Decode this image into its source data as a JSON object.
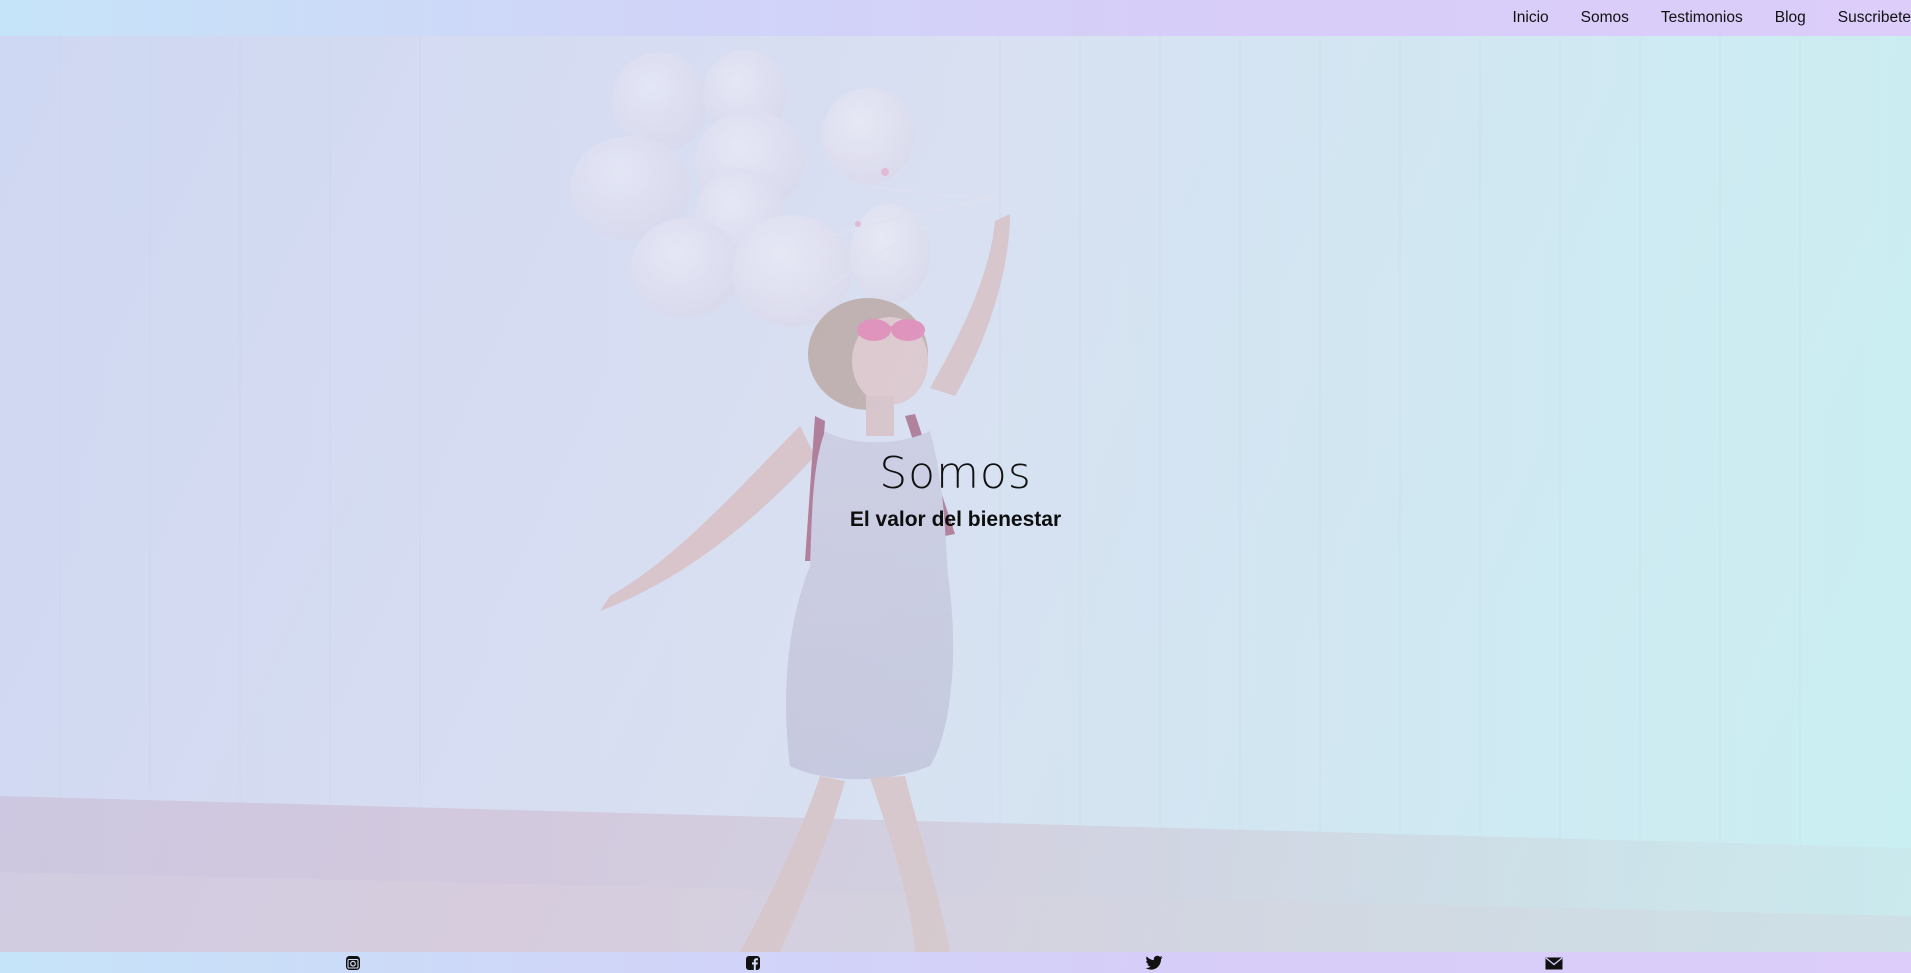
{
  "nav": {
    "items": [
      {
        "label": "Inicio"
      },
      {
        "label": "Somos"
      },
      {
        "label": "Testimonios"
      },
      {
        "label": "Blog"
      },
      {
        "label": "Suscribete"
      }
    ]
  },
  "hero": {
    "title": "Somos",
    "subtitle": "El valor del bienestar",
    "image": "woman-with-balloons-photo"
  },
  "footer": {
    "icons": [
      "instagram-icon",
      "facebook-icon",
      "twitter-icon",
      "mail-icon"
    ]
  },
  "colors": {
    "bar_gradient_start": "#c6e4f9",
    "bar_gradient_end": "#dccdfa",
    "text": "#111111"
  }
}
